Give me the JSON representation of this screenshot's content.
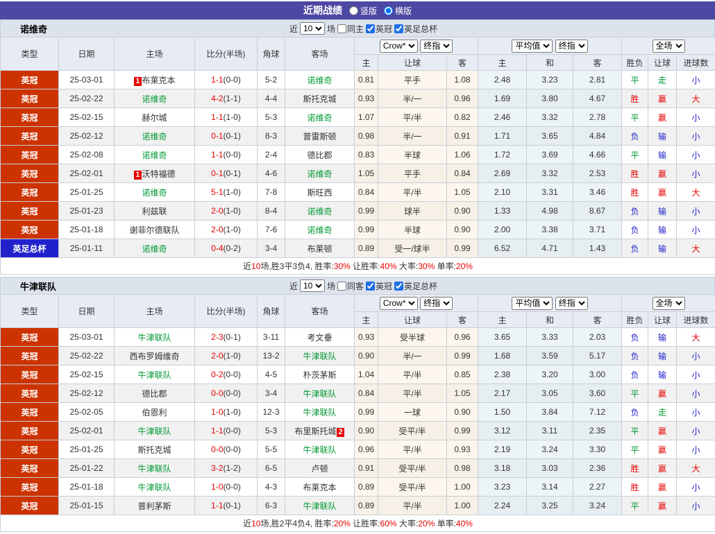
{
  "header": {
    "title": "近期战绩",
    "radio_vertical": "竖版",
    "radio_horizontal": "横版",
    "selected_layout": "horizontal"
  },
  "colors": {
    "topbar_purple": "#4d48a3",
    "type_league_red": "#cc3300",
    "type_cup_blue": "#2222cc",
    "focus_team_green": "#009933",
    "score_red": "#e60000",
    "result_red": "#e60000",
    "result_green": "#009933",
    "result_blue": "#2222cc",
    "crow_col_bg": "#fcf6ee",
    "avg_col_bg": "#ecf4f8",
    "filter_bar_bg": "#dce3ed",
    "header_bg": "#e7ecf4"
  },
  "filter_labels": {
    "near": "近",
    "games": "场"
  },
  "columns": {
    "type": "类型",
    "date": "日期",
    "home": "主场",
    "score": "比分(半场)",
    "corner": "角球",
    "away": "客场",
    "sub": [
      "主",
      "让球",
      "客",
      "主",
      "和",
      "客",
      "胜负",
      "让球",
      "进球数"
    ],
    "dropdowns": [
      "Crow*",
      "终指",
      "平均值",
      "终指",
      "全场"
    ]
  },
  "sections": [
    {
      "team": "诺维奇",
      "filter": {
        "count": "10",
        "same_label": "同主",
        "same_checked": false,
        "leagues": [
          {
            "label": "英冠",
            "checked": true
          },
          {
            "label": "英足总杯",
            "checked": true
          }
        ]
      },
      "rows": [
        {
          "type": "英冠",
          "cup": false,
          "date": "25-03-01",
          "home": {
            "name": "布莱克本",
            "badge": "1",
            "badge_pos": "before",
            "green": false
          },
          "score": "1-1",
          "half": "(0-0)",
          "corner": "5-2",
          "away": {
            "name": "诺维奇",
            "green": true
          },
          "crow": [
            "0.81",
            "平手",
            "1.08"
          ],
          "avg": [
            "2.48",
            "3.23",
            "2.81"
          ],
          "res": [
            [
              "平",
              "g"
            ],
            [
              "走",
              "g"
            ],
            [
              "小",
              "b"
            ]
          ]
        },
        {
          "type": "英冠",
          "cup": false,
          "date": "25-02-22",
          "home": {
            "name": "诺维奇",
            "green": true
          },
          "score": "4-2",
          "half": "(1-1)",
          "corner": "4-4",
          "away": {
            "name": "斯托克城",
            "green": false
          },
          "crow": [
            "0.93",
            "半/一",
            "0.96"
          ],
          "avg": [
            "1.69",
            "3.80",
            "4.67"
          ],
          "res": [
            [
              "胜",
              "r"
            ],
            [
              "赢",
              "r"
            ],
            [
              "大",
              "r"
            ]
          ]
        },
        {
          "type": "英冠",
          "cup": false,
          "date": "25-02-15",
          "home": {
            "name": "赫尔城",
            "green": false
          },
          "score": "1-1",
          "half": "(1-0)",
          "corner": "5-3",
          "away": {
            "name": "诺维奇",
            "green": true
          },
          "crow": [
            "1.07",
            "平/半",
            "0.82"
          ],
          "avg": [
            "2.46",
            "3.32",
            "2.78"
          ],
          "res": [
            [
              "平",
              "g"
            ],
            [
              "赢",
              "r"
            ],
            [
              "小",
              "b"
            ]
          ]
        },
        {
          "type": "英冠",
          "cup": false,
          "date": "25-02-12",
          "home": {
            "name": "诺维奇",
            "green": true
          },
          "score": "0-1",
          "half": "(0-1)",
          "corner": "8-3",
          "away": {
            "name": "普雷斯顿",
            "green": false
          },
          "crow": [
            "0.98",
            "半/一",
            "0.91"
          ],
          "avg": [
            "1.71",
            "3.65",
            "4.84"
          ],
          "res": [
            [
              "负",
              "b"
            ],
            [
              "输",
              "b"
            ],
            [
              "小",
              "b"
            ]
          ]
        },
        {
          "type": "英冠",
          "cup": false,
          "date": "25-02-08",
          "home": {
            "name": "诺维奇",
            "green": true
          },
          "score": "1-1",
          "half": "(0-0)",
          "corner": "2-4",
          "away": {
            "name": "德比郡",
            "green": false
          },
          "crow": [
            "0.83",
            "半球",
            "1.06"
          ],
          "avg": [
            "1.72",
            "3.69",
            "4.66"
          ],
          "res": [
            [
              "平",
              "g"
            ],
            [
              "输",
              "b"
            ],
            [
              "小",
              "b"
            ]
          ]
        },
        {
          "type": "英冠",
          "cup": false,
          "date": "25-02-01",
          "home": {
            "name": "沃特福德",
            "badge": "1",
            "badge_pos": "before",
            "green": false
          },
          "score": "0-1",
          "half": "(0-1)",
          "corner": "4-6",
          "away": {
            "name": "诺维奇",
            "green": true
          },
          "crow": [
            "1.05",
            "平手",
            "0.84"
          ],
          "avg": [
            "2.69",
            "3.32",
            "2.53"
          ],
          "res": [
            [
              "胜",
              "r"
            ],
            [
              "赢",
              "r"
            ],
            [
              "小",
              "b"
            ]
          ]
        },
        {
          "type": "英冠",
          "cup": false,
          "date": "25-01-25",
          "home": {
            "name": "诺维奇",
            "green": true
          },
          "score": "5-1",
          "half": "(1-0)",
          "corner": "7-8",
          "away": {
            "name": "斯旺西",
            "green": false
          },
          "crow": [
            "0.84",
            "平/半",
            "1.05"
          ],
          "avg": [
            "2.10",
            "3.31",
            "3.46"
          ],
          "res": [
            [
              "胜",
              "r"
            ],
            [
              "赢",
              "r"
            ],
            [
              "大",
              "r"
            ]
          ]
        },
        {
          "type": "英冠",
          "cup": false,
          "date": "25-01-23",
          "home": {
            "name": "利兹联",
            "green": false
          },
          "score": "2-0",
          "half": "(1-0)",
          "corner": "8-4",
          "away": {
            "name": "诺维奇",
            "green": true
          },
          "crow": [
            "0.99",
            "球半",
            "0.90"
          ],
          "avg": [
            "1.33",
            "4.98",
            "8.67"
          ],
          "res": [
            [
              "负",
              "b"
            ],
            [
              "输",
              "b"
            ],
            [
              "小",
              "b"
            ]
          ]
        },
        {
          "type": "英冠",
          "cup": false,
          "date": "25-01-18",
          "home": {
            "name": "谢菲尔德联队",
            "green": false
          },
          "score": "2-0",
          "half": "(1-0)",
          "corner": "7-6",
          "away": {
            "name": "诺维奇",
            "green": true
          },
          "crow": [
            "0.99",
            "半球",
            "0.90"
          ],
          "avg": [
            "2.00",
            "3.38",
            "3.71"
          ],
          "res": [
            [
              "负",
              "b"
            ],
            [
              "输",
              "b"
            ],
            [
              "小",
              "b"
            ]
          ]
        },
        {
          "type": "英足总杯",
          "cup": true,
          "date": "25-01-11",
          "home": {
            "name": "诺维奇",
            "green": true
          },
          "score": "0-4",
          "half": "(0-2)",
          "corner": "3-4",
          "away": {
            "name": "布莱顿",
            "green": false
          },
          "crow": [
            "0.89",
            "受一/球半",
            "0.99"
          ],
          "avg": [
            "6.52",
            "4.71",
            "1.43"
          ],
          "res": [
            [
              "负",
              "b"
            ],
            [
              "输",
              "b"
            ],
            [
              "大",
              "r"
            ]
          ]
        }
      ],
      "summary": [
        {
          "t": "近",
          "r": false
        },
        {
          "t": "10",
          "r": true
        },
        {
          "t": "场,胜3平3负4, 胜率:",
          "r": false
        },
        {
          "t": "30%",
          "r": true
        },
        {
          "t": " 让胜率:",
          "r": false
        },
        {
          "t": "40%",
          "r": true
        },
        {
          "t": " 大率:",
          "r": false
        },
        {
          "t": "30%",
          "r": true
        },
        {
          "t": " 单率:",
          "r": false
        },
        {
          "t": "20%",
          "r": true
        }
      ]
    },
    {
      "team": "牛津联队",
      "filter": {
        "count": "10",
        "same_label": "同客",
        "same_checked": false,
        "leagues": [
          {
            "label": "英冠",
            "checked": true
          },
          {
            "label": "英足总杯",
            "checked": true
          }
        ]
      },
      "rows": [
        {
          "type": "英冠",
          "cup": false,
          "date": "25-03-01",
          "home": {
            "name": "牛津联队",
            "green": true
          },
          "score": "2-3",
          "half": "(0-1)",
          "corner": "3-11",
          "away": {
            "name": "考文垂",
            "green": false
          },
          "crow": [
            "0.93",
            "受半球",
            "0.96"
          ],
          "avg": [
            "3.65",
            "3.33",
            "2.03"
          ],
          "res": [
            [
              "负",
              "b"
            ],
            [
              "输",
              "b"
            ],
            [
              "大",
              "r"
            ]
          ]
        },
        {
          "type": "英冠",
          "cup": false,
          "date": "25-02-22",
          "home": {
            "name": "西布罗姆维奇",
            "green": false
          },
          "score": "2-0",
          "half": "(1-0)",
          "corner": "13-2",
          "away": {
            "name": "牛津联队",
            "green": true
          },
          "crow": [
            "0.90",
            "半/一",
            "0.99"
          ],
          "avg": [
            "1.68",
            "3.59",
            "5.17"
          ],
          "res": [
            [
              "负",
              "b"
            ],
            [
              "输",
              "b"
            ],
            [
              "小",
              "b"
            ]
          ]
        },
        {
          "type": "英冠",
          "cup": false,
          "date": "25-02-15",
          "home": {
            "name": "牛津联队",
            "green": true
          },
          "score": "0-2",
          "half": "(0-0)",
          "corner": "4-5",
          "away": {
            "name": "朴茨茅斯",
            "green": false
          },
          "crow": [
            "1.04",
            "平/半",
            "0.85"
          ],
          "avg": [
            "2.38",
            "3.20",
            "3.00"
          ],
          "res": [
            [
              "负",
              "b"
            ],
            [
              "输",
              "b"
            ],
            [
              "小",
              "b"
            ]
          ]
        },
        {
          "type": "英冠",
          "cup": false,
          "date": "25-02-12",
          "home": {
            "name": "德比郡",
            "green": false
          },
          "score": "0-0",
          "half": "(0-0)",
          "corner": "3-4",
          "away": {
            "name": "牛津联队",
            "green": true
          },
          "crow": [
            "0.84",
            "平/半",
            "1.05"
          ],
          "avg": [
            "2.17",
            "3.05",
            "3.60"
          ],
          "res": [
            [
              "平",
              "g"
            ],
            [
              "赢",
              "r"
            ],
            [
              "小",
              "b"
            ]
          ]
        },
        {
          "type": "英冠",
          "cup": false,
          "date": "25-02-05",
          "home": {
            "name": "伯恩利",
            "green": false
          },
          "score": "1-0",
          "half": "(1-0)",
          "corner": "12-3",
          "away": {
            "name": "牛津联队",
            "green": true
          },
          "crow": [
            "0.99",
            "一球",
            "0.90"
          ],
          "avg": [
            "1.50",
            "3.84",
            "7.12"
          ],
          "res": [
            [
              "负",
              "b"
            ],
            [
              "走",
              "g"
            ],
            [
              "小",
              "b"
            ]
          ]
        },
        {
          "type": "英冠",
          "cup": false,
          "date": "25-02-01",
          "home": {
            "name": "牛津联队",
            "green": true
          },
          "score": "1-1",
          "half": "(0-0)",
          "corner": "5-3",
          "away": {
            "name": "布里斯托城",
            "badge": "2",
            "badge_pos": "after",
            "green": false
          },
          "crow": [
            "0.90",
            "受平/半",
            "0.99"
          ],
          "avg": [
            "3.12",
            "3.11",
            "2.35"
          ],
          "res": [
            [
              "平",
              "g"
            ],
            [
              "赢",
              "r"
            ],
            [
              "小",
              "b"
            ]
          ]
        },
        {
          "type": "英冠",
          "cup": false,
          "date": "25-01-25",
          "home": {
            "name": "斯托克城",
            "green": false
          },
          "score": "0-0",
          "half": "(0-0)",
          "corner": "5-5",
          "away": {
            "name": "牛津联队",
            "green": true
          },
          "crow": [
            "0.96",
            "平/半",
            "0.93"
          ],
          "avg": [
            "2.19",
            "3.24",
            "3.30"
          ],
          "res": [
            [
              "平",
              "g"
            ],
            [
              "赢",
              "r"
            ],
            [
              "小",
              "b"
            ]
          ]
        },
        {
          "type": "英冠",
          "cup": false,
          "date": "25-01-22",
          "home": {
            "name": "牛津联队",
            "green": true
          },
          "score": "3-2",
          "half": "(1-2)",
          "corner": "6-5",
          "away": {
            "name": "卢顿",
            "green": false
          },
          "crow": [
            "0.91",
            "受平/半",
            "0.98"
          ],
          "avg": [
            "3.18",
            "3.03",
            "2.36"
          ],
          "res": [
            [
              "胜",
              "r"
            ],
            [
              "赢",
              "r"
            ],
            [
              "大",
              "r"
            ]
          ]
        },
        {
          "type": "英冠",
          "cup": false,
          "date": "25-01-18",
          "home": {
            "name": "牛津联队",
            "green": true
          },
          "score": "1-0",
          "half": "(0-0)",
          "corner": "4-3",
          "away": {
            "name": "布莱克本",
            "green": false
          },
          "crow": [
            "0.89",
            "受平/半",
            "1.00"
          ],
          "avg": [
            "3.23",
            "3.14",
            "2.27"
          ],
          "res": [
            [
              "胜",
              "r"
            ],
            [
              "赢",
              "r"
            ],
            [
              "小",
              "b"
            ]
          ]
        },
        {
          "type": "英冠",
          "cup": false,
          "date": "25-01-15",
          "home": {
            "name": "普利茅斯",
            "green": false
          },
          "score": "1-1",
          "half": "(0-1)",
          "corner": "6-3",
          "away": {
            "name": "牛津联队",
            "green": true
          },
          "crow": [
            "0.89",
            "平/半",
            "1.00"
          ],
          "avg": [
            "2.24",
            "3.25",
            "3.24"
          ],
          "res": [
            [
              "平",
              "g"
            ],
            [
              "赢",
              "r"
            ],
            [
              "小",
              "b"
            ]
          ]
        }
      ],
      "summary": [
        {
          "t": "近",
          "r": false
        },
        {
          "t": "10",
          "r": true
        },
        {
          "t": "场,胜2平4负4, 胜率:",
          "r": false
        },
        {
          "t": "20%",
          "r": true
        },
        {
          "t": " 让胜率:",
          "r": false
        },
        {
          "t": "60%",
          "r": true
        },
        {
          "t": " 大率:",
          "r": false
        },
        {
          "t": "20%",
          "r": true
        },
        {
          "t": " 单率:",
          "r": false
        },
        {
          "t": "40%",
          "r": true
        }
      ]
    }
  ]
}
